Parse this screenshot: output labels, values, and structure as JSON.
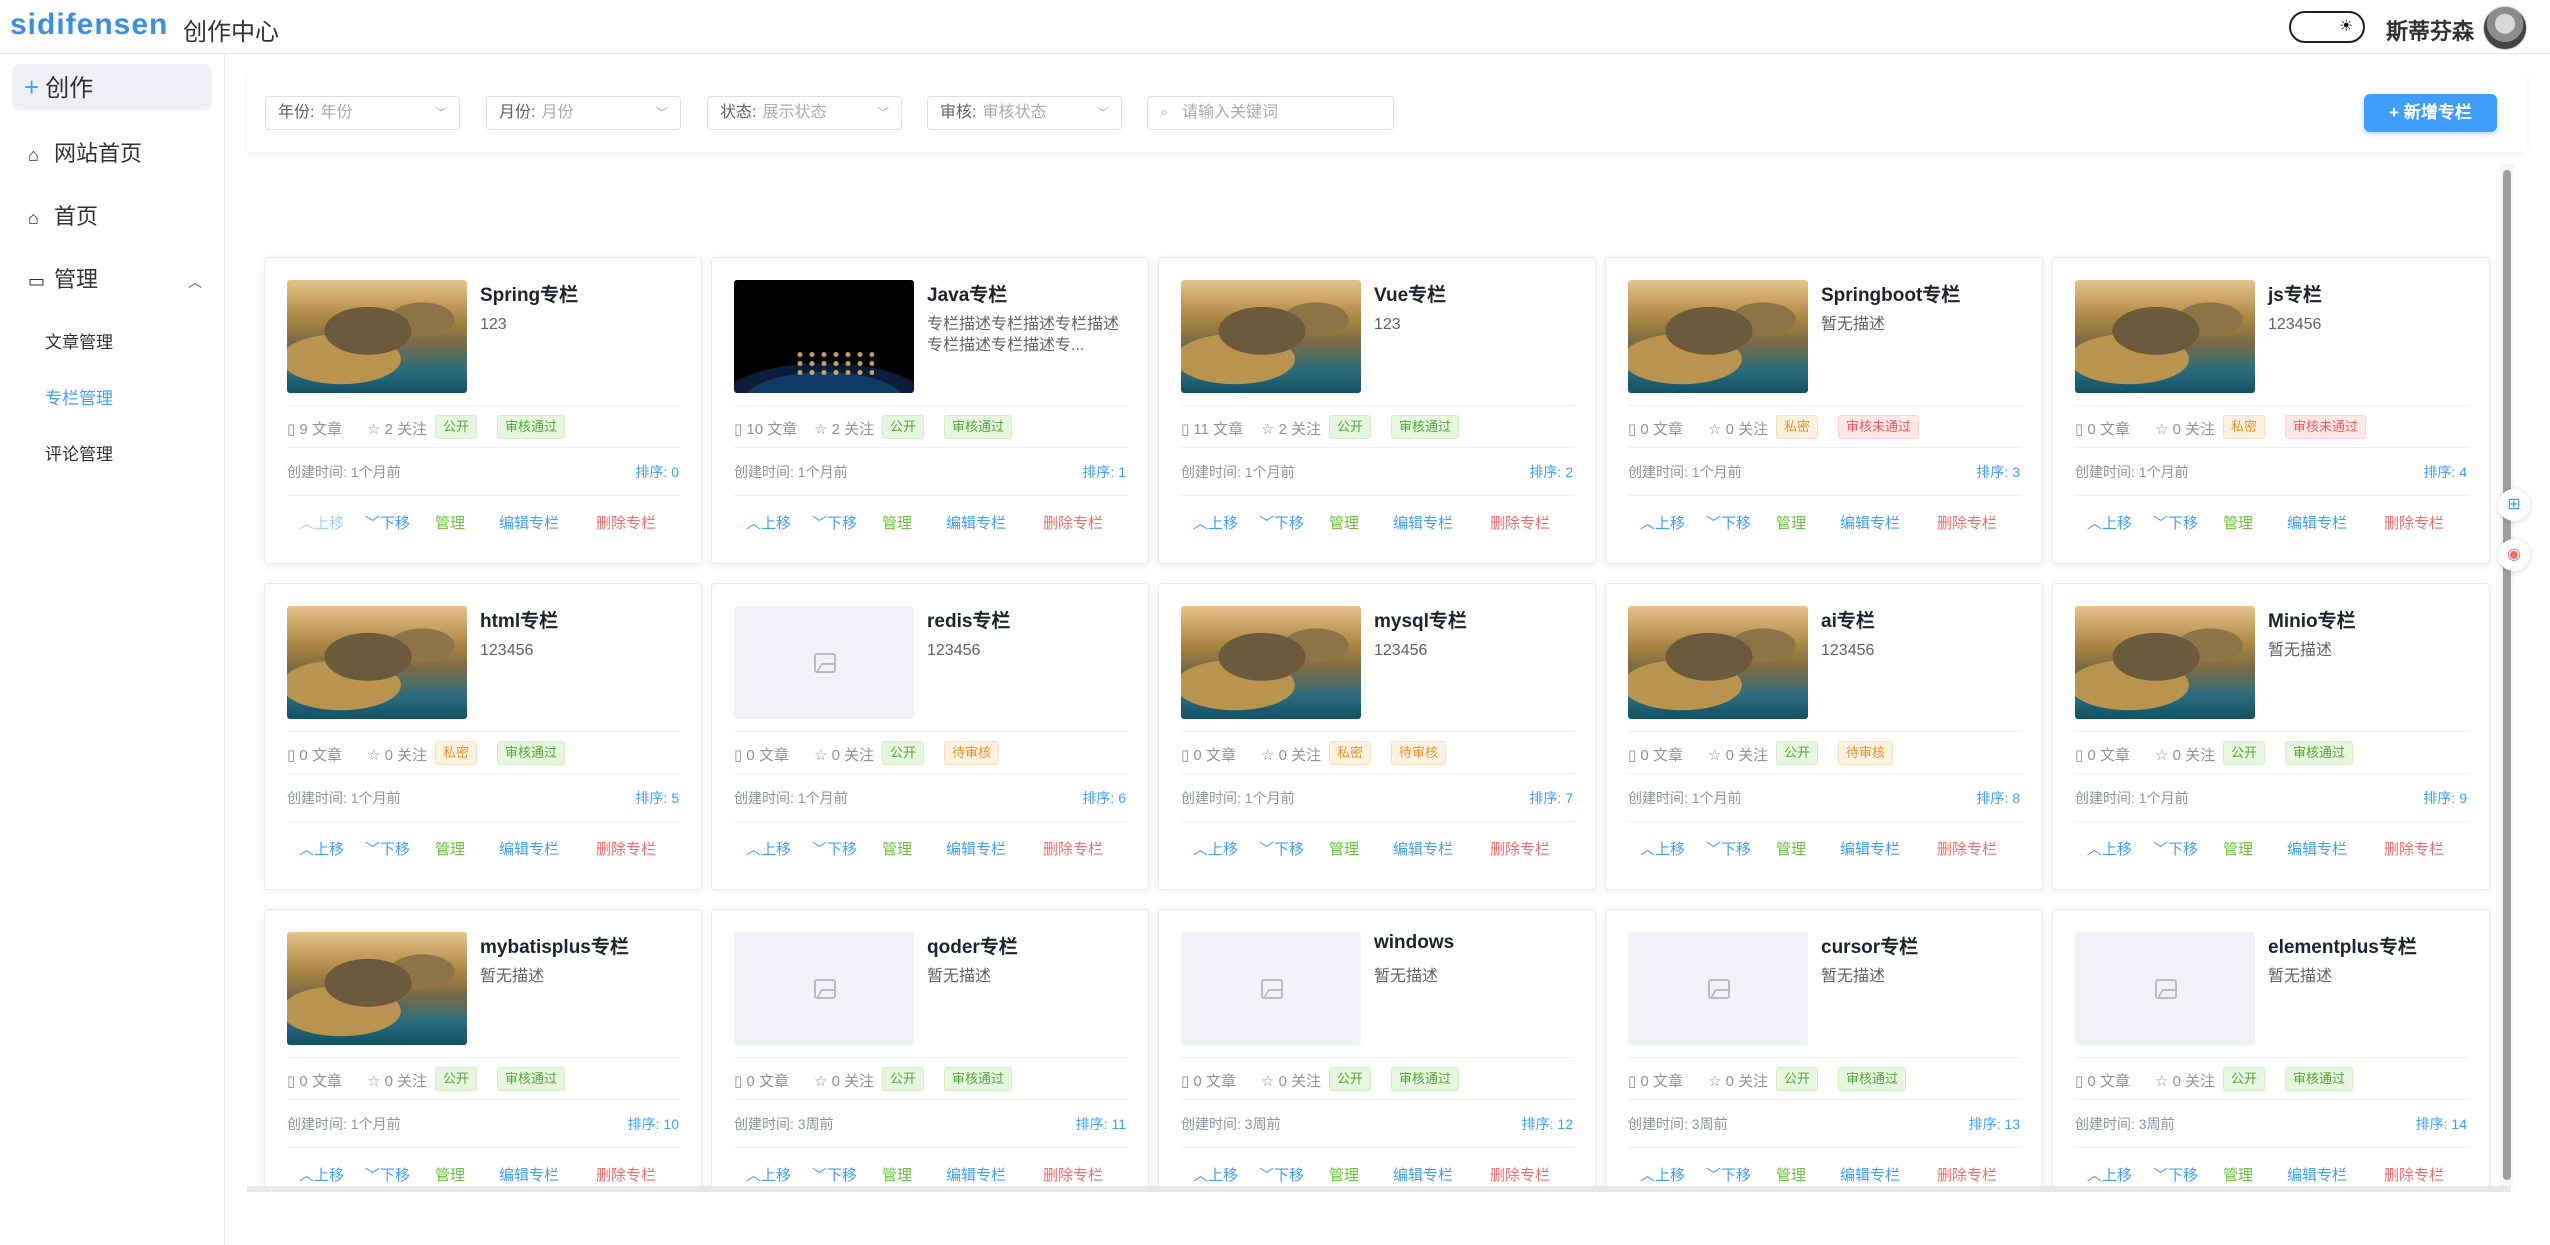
{
  "app": {
    "logo": "sidifensen",
    "subtitle": "创作中心",
    "username": "斯蒂芬森"
  },
  "sidebar": {
    "create": "创作",
    "items": [
      {
        "label": "网站首页"
      },
      {
        "label": "首页"
      },
      {
        "label": "管理"
      }
    ],
    "sub_items": [
      {
        "label": "文章管理"
      },
      {
        "label": "专栏管理"
      },
      {
        "label": "评论管理"
      }
    ]
  },
  "filters": {
    "year": {
      "label": "年份:",
      "placeholder": "年份"
    },
    "month": {
      "label": "月份:",
      "placeholder": "月份"
    },
    "status": {
      "label": "状态:",
      "placeholder": "展示状态"
    },
    "audit": {
      "label": "审核:",
      "placeholder": "审核状态"
    },
    "search_placeholder": "请输入关键词",
    "add_button": "新增专栏"
  },
  "labels": {
    "created": "创建时间:",
    "sort": "排序:",
    "articles_suffix": "文章",
    "follows_suffix": "关注",
    "up": "上移",
    "down": "下移",
    "manage": "管理",
    "edit": "编辑专栏",
    "delete": "删除专栏"
  },
  "columns": [
    {
      "title": "Spring专栏",
      "desc": "123",
      "articles": "9",
      "follows": "2",
      "visibility": "公开",
      "audit": "审核通过",
      "created": "1个月前",
      "sort": "0",
      "image": "rock",
      "first": true
    },
    {
      "title": "Java专栏",
      "desc": "专栏描述专栏描述专栏描述专栏描述专栏描述专...",
      "articles": "10",
      "follows": "2",
      "visibility": "公开",
      "audit": "审核通过",
      "created": "1个月前",
      "sort": "1",
      "image": "earth"
    },
    {
      "title": "Vue专栏",
      "desc": "123",
      "articles": "11",
      "follows": "2",
      "visibility": "公开",
      "audit": "审核通过",
      "created": "1个月前",
      "sort": "2",
      "image": "rock"
    },
    {
      "title": "Springboot专栏",
      "desc": "暂无描述",
      "articles": "0",
      "follows": "0",
      "visibility": "私密",
      "audit": "审核未通过",
      "created": "1个月前",
      "sort": "3",
      "image": "rock"
    },
    {
      "title": "js专栏",
      "desc": "123456",
      "articles": "0",
      "follows": "0",
      "visibility": "私密",
      "audit": "审核未通过",
      "created": "1个月前",
      "sort": "4",
      "image": "rock"
    },
    {
      "title": "html专栏",
      "desc": "123456",
      "articles": "0",
      "follows": "0",
      "visibility": "私密",
      "audit": "审核通过",
      "created": "1个月前",
      "sort": "5",
      "image": "rock"
    },
    {
      "title": "redis专栏",
      "desc": "123456",
      "articles": "0",
      "follows": "0",
      "visibility": "公开",
      "audit": "待审核",
      "created": "1个月前",
      "sort": "6",
      "image": "empty"
    },
    {
      "title": "mysql专栏",
      "desc": "123456",
      "articles": "0",
      "follows": "0",
      "visibility": "私密",
      "audit": "待审核",
      "created": "1个月前",
      "sort": "7",
      "image": "rock"
    },
    {
      "title": "ai专栏",
      "desc": "123456",
      "articles": "0",
      "follows": "0",
      "visibility": "公开",
      "audit": "待审核",
      "created": "1个月前",
      "sort": "8",
      "image": "rock"
    },
    {
      "title": "Minio专栏",
      "desc": "暂无描述",
      "articles": "0",
      "follows": "0",
      "visibility": "公开",
      "audit": "审核通过",
      "created": "1个月前",
      "sort": "9",
      "image": "rock"
    },
    {
      "title": "mybatisplus专栏",
      "desc": "暂无描述",
      "articles": "0",
      "follows": "0",
      "visibility": "公开",
      "audit": "审核通过",
      "created": "1个月前",
      "sort": "10",
      "image": "rock"
    },
    {
      "title": "qoder专栏",
      "desc": "暂无描述",
      "articles": "0",
      "follows": "0",
      "visibility": "公开",
      "audit": "审核通过",
      "created": "3周前",
      "sort": "11",
      "image": "empty"
    },
    {
      "title": "windows",
      "desc": "暂无描述",
      "articles": "0",
      "follows": "0",
      "visibility": "公开",
      "audit": "审核通过",
      "created": "3周前",
      "sort": "12",
      "image": "empty"
    },
    {
      "title": "cursor专栏",
      "desc": "暂无描述",
      "articles": "0",
      "follows": "0",
      "visibility": "公开",
      "audit": "审核通过",
      "created": "3周前",
      "sort": "13",
      "image": "empty"
    },
    {
      "title": "elementplus专栏",
      "desc": "暂无描述",
      "articles": "0",
      "follows": "0",
      "visibility": "公开",
      "audit": "审核通过",
      "created": "3周前",
      "sort": "14",
      "image": "empty"
    }
  ],
  "colors": {
    "accent": "#409eff",
    "success": "#67c23a",
    "danger": "#f56c6c",
    "warning": "#e6932b"
  }
}
